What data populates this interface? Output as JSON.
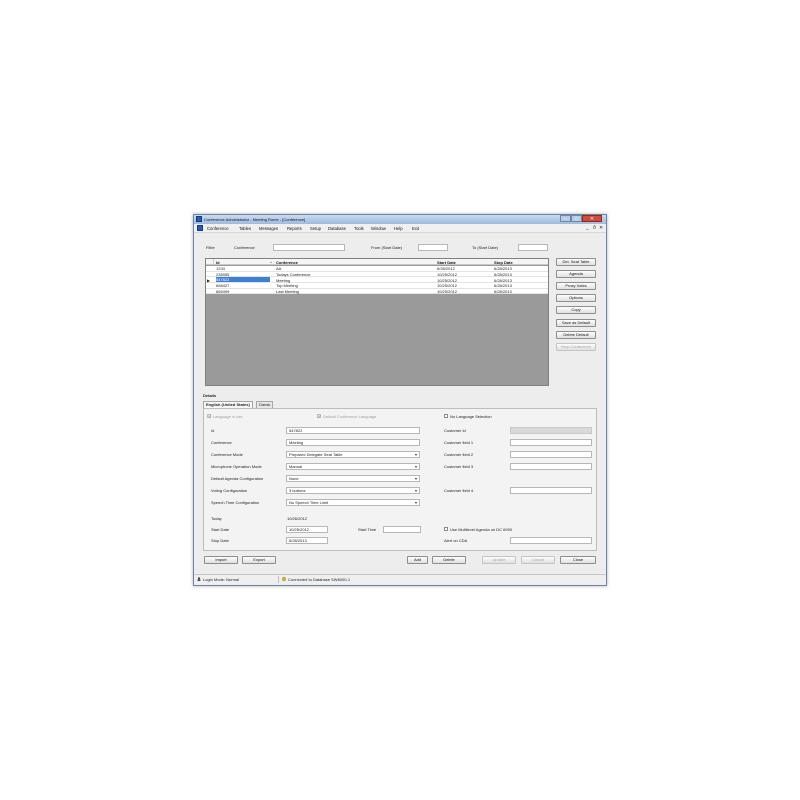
{
  "window": {
    "title": "Conference Administrator - Meeting Rome - [Conference]",
    "controls": {
      "minimize": "–",
      "maximize": "□",
      "close": "✕"
    },
    "mdi_controls": {
      "minimize": "_",
      "restore": "ð",
      "close": "✕"
    }
  },
  "menu": [
    "Conference",
    "Tables",
    "Messages",
    "Reports",
    "Setup",
    "Database",
    "Tools",
    "Window",
    "Help",
    "Exit"
  ],
  "filter": {
    "label": "Filter",
    "conference_label": "Conference",
    "conference_value": "",
    "from_label": "From (Start Date)",
    "from_value": "",
    "to_label": "To (Start Date)",
    "to_value": ""
  },
  "table": {
    "columns": [
      "Id",
      "Conference",
      "Start Date",
      "Stop Date"
    ],
    "sort_indicator": "^",
    "current_row_marker": "▶",
    "rows": [
      {
        "id": "1234",
        "conference": "AA",
        "start": "6/28/2012",
        "stop": "6/28/2013",
        "selected": false
      },
      {
        "id": "236955",
        "conference": "Todays Conference",
        "start": "10/25/2012",
        "stop": "6/28/2013",
        "selected": false
      },
      {
        "id": "547822",
        "conference": "Meeting",
        "start": "10/25/2012",
        "stop": "6/28/2013",
        "selected": true
      },
      {
        "id": "658427",
        "conference": "Top Meeting",
        "start": "10/25/2012",
        "stop": "6/28/2013",
        "selected": false
      },
      {
        "id": "665499",
        "conference": "Last Meeting",
        "start": "10/25/2012",
        "stop": "6/28/2013",
        "selected": false
      }
    ]
  },
  "side_buttons": {
    "del_seat_table": "Del. Seat Table",
    "agenda": "Agenda",
    "proxy_votes": "Proxy Votes",
    "options": "Options",
    "copy": "Copy",
    "save_as_default": "Save as Default",
    "delete_default": "Delete Default",
    "stop_conference": "Stop Conference"
  },
  "details": {
    "heading": "Details",
    "tabs": [
      "English (United States)",
      "Dansk"
    ],
    "language_in_use": "Language in use",
    "default_conference_language": "Default Conference Language",
    "no_language_selection": "No Language Selection",
    "fields": {
      "id_label": "Id",
      "id_value": "547822",
      "conference_label": "Conference",
      "conference_value": "Meeting",
      "mode_label": "Conference Mode",
      "mode_value": "Prepared Delegate Seat Table",
      "mic_label": "Microphone Operation Mode",
      "mic_value": "Manual",
      "agenda_cfg_label": "Default Agenda Configuration",
      "agenda_cfg_value": "None",
      "voting_label": "Voting Configuration",
      "voting_value": "3 buttons",
      "speech_label": "Speech Time Configuration",
      "speech_value": "No Speech Time Limit",
      "today_label": "Today",
      "today_value": "10/26/2012",
      "start_date_label": "Start Date",
      "start_date_value": "10/25/2012",
      "start_time_label": "Start Time",
      "start_time_value": "",
      "stop_date_label": "Stop Date",
      "stop_date_value": "6/28/2013",
      "customer_id_label": "Customer Id",
      "customer_id_value": "",
      "cf1_label": "Customer field 1",
      "cf1_value": "",
      "cf2_label": "Customer field 2",
      "cf2_value": "",
      "cf3_label": "Customer field 3",
      "cf3_value": "",
      "cf4_label": "Customer field 4",
      "cf4_value": "",
      "multilevel_label": "Use Multilevel Agenda on DC 6990",
      "alert_label": "Alert on CDA",
      "alert_value": ""
    }
  },
  "bottom_buttons": {
    "import": "Import",
    "export": "Export",
    "add": "Add",
    "delete": "Delete",
    "update": "Update",
    "cancel": "Cancel",
    "close": "Close"
  },
  "status": {
    "login_mode": "Login Mode: Normal",
    "connection": "Connected to Database SW6000-1"
  }
}
